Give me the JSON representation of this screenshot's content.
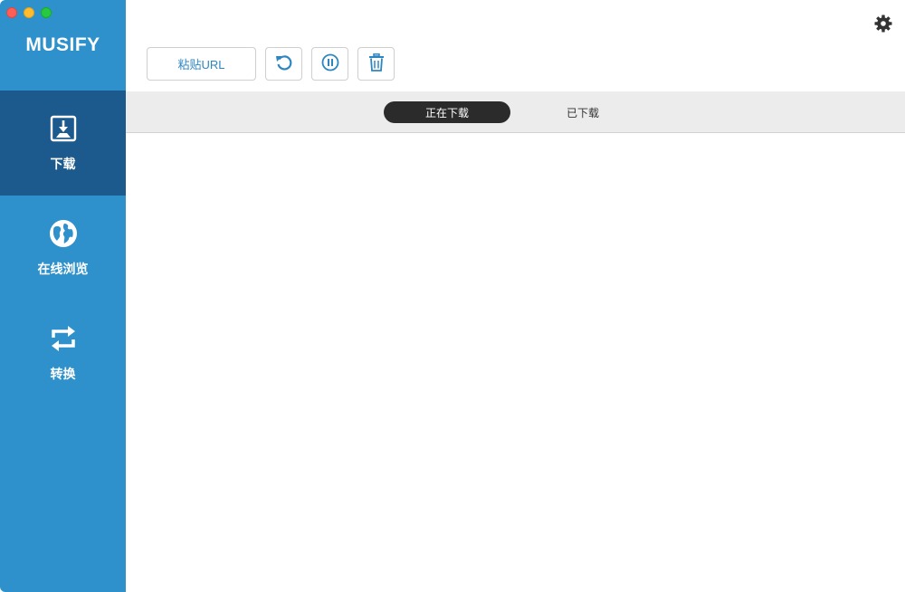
{
  "app": {
    "brand": "MUSIFY"
  },
  "sidebar": {
    "items": [
      {
        "label": "下载",
        "icon": "download-icon",
        "active": true
      },
      {
        "label": "在线浏览",
        "icon": "globe-icon",
        "active": false
      },
      {
        "label": "转换",
        "icon": "convert-icon",
        "active": false
      }
    ]
  },
  "toolbar": {
    "paste_label": "粘贴URL",
    "retry_icon": "refresh-icon",
    "pause_icon": "pause-icon",
    "delete_icon": "trash-icon"
  },
  "tabs": [
    {
      "label": "正在下载",
      "active": true
    },
    {
      "label": "已下载",
      "active": false
    }
  ],
  "colors": {
    "sidebar": "#2e91cb",
    "sidebar_active": "#1c5a8d",
    "accent": "#2e86c1",
    "tab_active": "#2b2b2b"
  }
}
